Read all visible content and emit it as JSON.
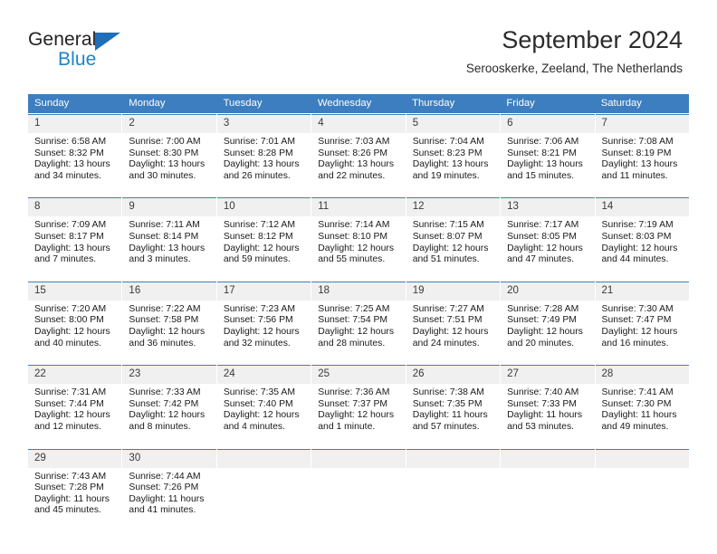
{
  "brand": {
    "name_top": "General",
    "name_bottom": "Blue",
    "accent_color": "#2083c8",
    "triangle_color": "#1e6fba"
  },
  "header": {
    "title": "September 2024",
    "subtitle": "Serooskerke, Zeeland, The Netherlands"
  },
  "calendar": {
    "header_bg": "#3c7ebf",
    "daynum_bg": "#f0f0f0",
    "weekdays": [
      "Sunday",
      "Monday",
      "Tuesday",
      "Wednesday",
      "Thursday",
      "Friday",
      "Saturday"
    ],
    "weeks": [
      [
        {
          "day": "1",
          "sunrise": "Sunrise: 6:58 AM",
          "sunset": "Sunset: 8:32 PM",
          "daylight_1": "Daylight: 13 hours",
          "daylight_2": "and 34 minutes."
        },
        {
          "day": "2",
          "sunrise": "Sunrise: 7:00 AM",
          "sunset": "Sunset: 8:30 PM",
          "daylight_1": "Daylight: 13 hours",
          "daylight_2": "and 30 minutes."
        },
        {
          "day": "3",
          "sunrise": "Sunrise: 7:01 AM",
          "sunset": "Sunset: 8:28 PM",
          "daylight_1": "Daylight: 13 hours",
          "daylight_2": "and 26 minutes."
        },
        {
          "day": "4",
          "sunrise": "Sunrise: 7:03 AM",
          "sunset": "Sunset: 8:26 PM",
          "daylight_1": "Daylight: 13 hours",
          "daylight_2": "and 22 minutes."
        },
        {
          "day": "5",
          "sunrise": "Sunrise: 7:04 AM",
          "sunset": "Sunset: 8:23 PM",
          "daylight_1": "Daylight: 13 hours",
          "daylight_2": "and 19 minutes."
        },
        {
          "day": "6",
          "sunrise": "Sunrise: 7:06 AM",
          "sunset": "Sunset: 8:21 PM",
          "daylight_1": "Daylight: 13 hours",
          "daylight_2": "and 15 minutes."
        },
        {
          "day": "7",
          "sunrise": "Sunrise: 7:08 AM",
          "sunset": "Sunset: 8:19 PM",
          "daylight_1": "Daylight: 13 hours",
          "daylight_2": "and 11 minutes."
        }
      ],
      [
        {
          "day": "8",
          "sunrise": "Sunrise: 7:09 AM",
          "sunset": "Sunset: 8:17 PM",
          "daylight_1": "Daylight: 13 hours",
          "daylight_2": "and 7 minutes."
        },
        {
          "day": "9",
          "sunrise": "Sunrise: 7:11 AM",
          "sunset": "Sunset: 8:14 PM",
          "daylight_1": "Daylight: 13 hours",
          "daylight_2": "and 3 minutes."
        },
        {
          "day": "10",
          "sunrise": "Sunrise: 7:12 AM",
          "sunset": "Sunset: 8:12 PM",
          "daylight_1": "Daylight: 12 hours",
          "daylight_2": "and 59 minutes."
        },
        {
          "day": "11",
          "sunrise": "Sunrise: 7:14 AM",
          "sunset": "Sunset: 8:10 PM",
          "daylight_1": "Daylight: 12 hours",
          "daylight_2": "and 55 minutes."
        },
        {
          "day": "12",
          "sunrise": "Sunrise: 7:15 AM",
          "sunset": "Sunset: 8:07 PM",
          "daylight_1": "Daylight: 12 hours",
          "daylight_2": "and 51 minutes."
        },
        {
          "day": "13",
          "sunrise": "Sunrise: 7:17 AM",
          "sunset": "Sunset: 8:05 PM",
          "daylight_1": "Daylight: 12 hours",
          "daylight_2": "and 47 minutes."
        },
        {
          "day": "14",
          "sunrise": "Sunrise: 7:19 AM",
          "sunset": "Sunset: 8:03 PM",
          "daylight_1": "Daylight: 12 hours",
          "daylight_2": "and 44 minutes."
        }
      ],
      [
        {
          "day": "15",
          "sunrise": "Sunrise: 7:20 AM",
          "sunset": "Sunset: 8:00 PM",
          "daylight_1": "Daylight: 12 hours",
          "daylight_2": "and 40 minutes."
        },
        {
          "day": "16",
          "sunrise": "Sunrise: 7:22 AM",
          "sunset": "Sunset: 7:58 PM",
          "daylight_1": "Daylight: 12 hours",
          "daylight_2": "and 36 minutes."
        },
        {
          "day": "17",
          "sunrise": "Sunrise: 7:23 AM",
          "sunset": "Sunset: 7:56 PM",
          "daylight_1": "Daylight: 12 hours",
          "daylight_2": "and 32 minutes."
        },
        {
          "day": "18",
          "sunrise": "Sunrise: 7:25 AM",
          "sunset": "Sunset: 7:54 PM",
          "daylight_1": "Daylight: 12 hours",
          "daylight_2": "and 28 minutes."
        },
        {
          "day": "19",
          "sunrise": "Sunrise: 7:27 AM",
          "sunset": "Sunset: 7:51 PM",
          "daylight_1": "Daylight: 12 hours",
          "daylight_2": "and 24 minutes."
        },
        {
          "day": "20",
          "sunrise": "Sunrise: 7:28 AM",
          "sunset": "Sunset: 7:49 PM",
          "daylight_1": "Daylight: 12 hours",
          "daylight_2": "and 20 minutes."
        },
        {
          "day": "21",
          "sunrise": "Sunrise: 7:30 AM",
          "sunset": "Sunset: 7:47 PM",
          "daylight_1": "Daylight: 12 hours",
          "daylight_2": "and 16 minutes."
        }
      ],
      [
        {
          "day": "22",
          "sunrise": "Sunrise: 7:31 AM",
          "sunset": "Sunset: 7:44 PM",
          "daylight_1": "Daylight: 12 hours",
          "daylight_2": "and 12 minutes."
        },
        {
          "day": "23",
          "sunrise": "Sunrise: 7:33 AM",
          "sunset": "Sunset: 7:42 PM",
          "daylight_1": "Daylight: 12 hours",
          "daylight_2": "and 8 minutes."
        },
        {
          "day": "24",
          "sunrise": "Sunrise: 7:35 AM",
          "sunset": "Sunset: 7:40 PM",
          "daylight_1": "Daylight: 12 hours",
          "daylight_2": "and 4 minutes."
        },
        {
          "day": "25",
          "sunrise": "Sunrise: 7:36 AM",
          "sunset": "Sunset: 7:37 PM",
          "daylight_1": "Daylight: 12 hours",
          "daylight_2": "and 1 minute."
        },
        {
          "day": "26",
          "sunrise": "Sunrise: 7:38 AM",
          "sunset": "Sunset: 7:35 PM",
          "daylight_1": "Daylight: 11 hours",
          "daylight_2": "and 57 minutes."
        },
        {
          "day": "27",
          "sunrise": "Sunrise: 7:40 AM",
          "sunset": "Sunset: 7:33 PM",
          "daylight_1": "Daylight: 11 hours",
          "daylight_2": "and 53 minutes."
        },
        {
          "day": "28",
          "sunrise": "Sunrise: 7:41 AM",
          "sunset": "Sunset: 7:30 PM",
          "daylight_1": "Daylight: 11 hours",
          "daylight_2": "and 49 minutes."
        }
      ],
      [
        {
          "day": "29",
          "sunrise": "Sunrise: 7:43 AM",
          "sunset": "Sunset: 7:28 PM",
          "daylight_1": "Daylight: 11 hours",
          "daylight_2": "and 45 minutes."
        },
        {
          "day": "30",
          "sunrise": "Sunrise: 7:44 AM",
          "sunset": "Sunset: 7:26 PM",
          "daylight_1": "Daylight: 11 hours",
          "daylight_2": "and 41 minutes."
        },
        {
          "day": "",
          "sunrise": "",
          "sunset": "",
          "daylight_1": "",
          "daylight_2": ""
        },
        {
          "day": "",
          "sunrise": "",
          "sunset": "",
          "daylight_1": "",
          "daylight_2": ""
        },
        {
          "day": "",
          "sunrise": "",
          "sunset": "",
          "daylight_1": "",
          "daylight_2": ""
        },
        {
          "day": "",
          "sunrise": "",
          "sunset": "",
          "daylight_1": "",
          "daylight_2": ""
        },
        {
          "day": "",
          "sunrise": "",
          "sunset": "",
          "daylight_1": "",
          "daylight_2": ""
        }
      ]
    ]
  }
}
